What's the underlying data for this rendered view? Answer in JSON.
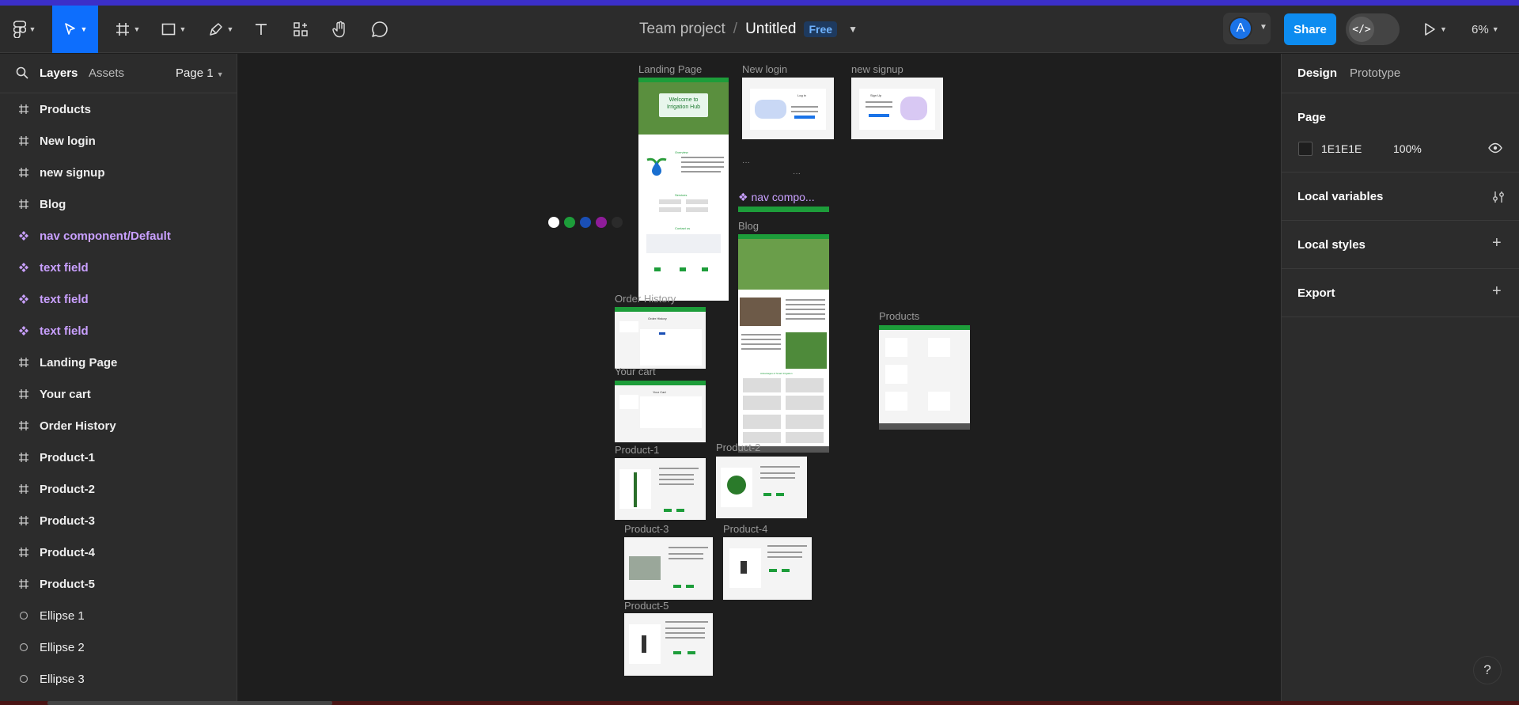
{
  "toolbar": {
    "file": {
      "team": "Team project",
      "separator": "/",
      "name": "Untitled",
      "plan": "Free"
    },
    "avatar_initial": "A",
    "share_label": "Share",
    "dev_mode_label": "</>",
    "zoom": "6%",
    "tools": [
      "main-menu-icon",
      "move-icon",
      "frame-icon",
      "rectangle-icon",
      "pen-icon",
      "text-icon",
      "actions-icon",
      "hand-icon",
      "comment-icon"
    ]
  },
  "left_panel": {
    "tabs": {
      "layers": "Layers",
      "assets": "Assets"
    },
    "page": "Page 1",
    "layers": [
      {
        "label": "Products",
        "type": "frame"
      },
      {
        "label": "New login",
        "type": "frame"
      },
      {
        "label": "new signup",
        "type": "frame"
      },
      {
        "label": "Blog",
        "type": "frame"
      },
      {
        "label": "nav component/Default",
        "type": "component"
      },
      {
        "label": "text field",
        "type": "component"
      },
      {
        "label": "text field",
        "type": "component"
      },
      {
        "label": "text field",
        "type": "component"
      },
      {
        "label": "Landing Page",
        "type": "frame"
      },
      {
        "label": "Your cart",
        "type": "frame"
      },
      {
        "label": "Order History",
        "type": "frame"
      },
      {
        "label": "Product-1",
        "type": "frame"
      },
      {
        "label": "Product-2",
        "type": "frame"
      },
      {
        "label": "Product-3",
        "type": "frame"
      },
      {
        "label": "Product-4",
        "type": "frame"
      },
      {
        "label": "Product-5",
        "type": "frame"
      },
      {
        "label": "Ellipse 1",
        "type": "ellipse"
      },
      {
        "label": "Ellipse 2",
        "type": "ellipse"
      },
      {
        "label": "Ellipse 3",
        "type": "ellipse"
      }
    ]
  },
  "right_panel": {
    "tabs": {
      "design": "Design",
      "prototype": "Prototype"
    },
    "page_title": "Page",
    "page_color": "1E1E1E",
    "page_opacity": "100%",
    "local_variables": "Local variables",
    "local_styles": "Local styles",
    "export": "Export"
  },
  "canvas": {
    "frames": {
      "landing": "Landing Page",
      "new_login": "New login",
      "new_signup": "new signup",
      "nav_component": "nav compo...",
      "blog": "Blog",
      "order_history": "Order History",
      "your_cart": "Your cart",
      "products": "Products",
      "product1": "Product-1",
      "product2": "Product-2",
      "product3": "Product-3",
      "product4": "Product-4",
      "product5": "Product-5"
    },
    "ellipse_colors": [
      "#ffffff",
      "#1d9d3a",
      "#1a4fb5",
      "#8e1c99",
      "#2b2b2b"
    ],
    "inner_text": {
      "welcome": "Welcome to Irrigation Hub",
      "overview": "Overview",
      "services": "Services",
      "contact": "Contact us",
      "order_history_heading": "Order History",
      "your_cart_heading": "Your Cart",
      "login_heading": "Log in",
      "signup_heading": "Sign Up",
      "advantages": "Advantages of Smart Irrigation"
    }
  },
  "help_label": "?"
}
